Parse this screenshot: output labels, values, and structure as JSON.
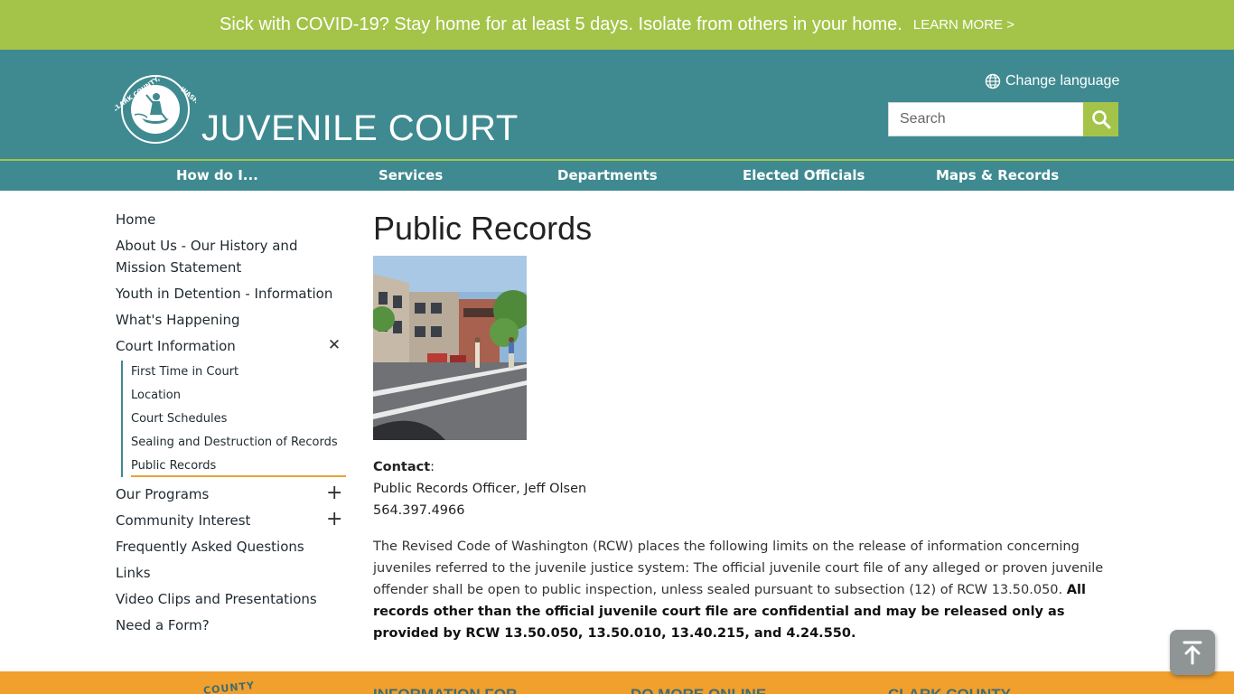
{
  "alert": {
    "message": "Sick with COVID-19? Stay home for at least 5 days. Isolate from others in your home.",
    "link": "LEARN MORE >"
  },
  "header": {
    "logo_text": "CLARK COUNTY, WASHINGTON",
    "title": "JUVENILE COURT",
    "language": "Change language",
    "search_placeholder": "Search"
  },
  "nav": {
    "items": [
      "How do I...",
      "Services",
      "Departments",
      "Elected Officials",
      "Maps & Records"
    ]
  },
  "sidebar": {
    "items": [
      "Home",
      "About Us - Our History and Mission Statement",
      "Youth in Detention - Information",
      "What's Happening",
      "Court Information",
      "Our Programs",
      "Community Interest",
      "Frequently Asked Questions",
      "Links",
      "Video Clips and Presentations",
      "Need a Form?"
    ],
    "sub_items": [
      "First Time in Court",
      "Location",
      "Court Schedules",
      "Sealing and Destruction of Records",
      "Public Records"
    ],
    "collapse_symbol": "✕",
    "expand_symbol": "+"
  },
  "main": {
    "title": "Public Records",
    "contact_label": "Contact",
    "contact_colon": ":",
    "contact_name": "Public Records Officer, Jeff Olsen",
    "contact_phone": "564.397.4966",
    "para_text": "The Revised Code of Washington (RCW) places the following limits on the release of information concerning juveniles referred to the juvenile justice system: The official juvenile court file of any alleged or proven juvenile offender shall be open to public inspection, unless sealed pursuant to subsection (12) of RCW 13.50.050. ",
    "para_bold": "All records other than the official juvenile court file are confidential and may be released only as provided by RCW 13.50.050, 13.50.010, 13.40.215, and 4.24.550."
  },
  "footer": {
    "county": "COUNTY",
    "columns": [
      "INFORMATION FOR",
      "DO MORE ONLINE",
      "CLARK COUNTY"
    ]
  },
  "colors": {
    "alert_green": "#a4c449",
    "header_teal": "#3f8a91",
    "footer_orange": "#f19f2d",
    "active_underline": "#e5a336"
  },
  "icons": {
    "language": "globe-icon",
    "search": "magnifier-icon",
    "scroll_top": "arrow-up-to-top-icon"
  }
}
